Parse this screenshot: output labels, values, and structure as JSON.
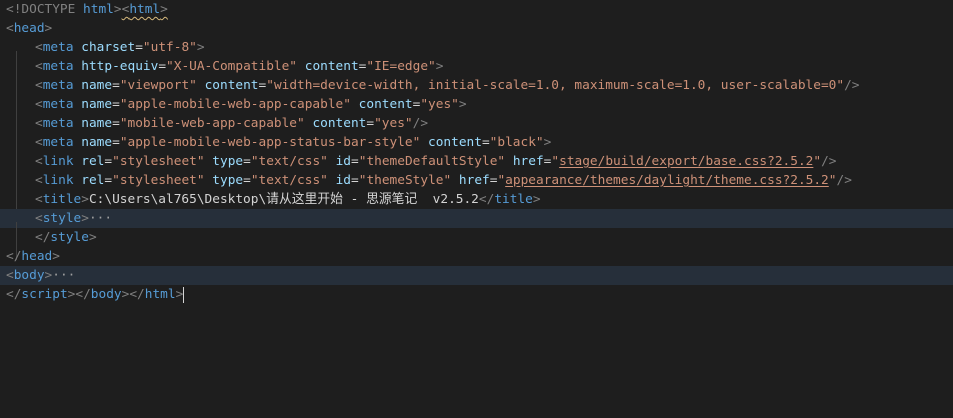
{
  "editor": {
    "lines": [
      {
        "doctype": "<!DOCTYPE ",
        "doctype_kw": "html",
        "close": ">",
        "html_open": "<",
        "html_tag": "html",
        "html_close": ">"
      },
      {
        "open": "<",
        "tag": "head",
        "close": ">"
      },
      {
        "open": "<",
        "tag": "meta",
        "attr1": "charset",
        "val1": "\"utf-8\"",
        "end": ">"
      },
      {
        "open": "<",
        "tag": "meta",
        "attr1": "http-equiv",
        "val1": "\"X-UA-Compatible\"",
        "attr2": "content",
        "val2": "\"IE=edge\"",
        "end": ">"
      },
      {
        "open": "<",
        "tag": "meta",
        "attr1": "name",
        "val1": "\"viewport\"",
        "attr2": "content",
        "val2": "\"width=device-width, initial-scale=1.0, maximum-scale=1.0, user-scalable=0\"",
        "end": "/>"
      },
      {
        "open": "<",
        "tag": "meta",
        "attr1": "name",
        "val1": "\"apple-mobile-web-app-capable\"",
        "attr2": "content",
        "val2": "\"yes\"",
        "end": ">"
      },
      {
        "open": "<",
        "tag": "meta",
        "attr1": "name",
        "val1": "\"mobile-web-app-capable\"",
        "attr2": "content",
        "val2": "\"yes\"",
        "end": "/>"
      },
      {
        "open": "<",
        "tag": "meta",
        "attr1": "name",
        "val1": "\"apple-mobile-web-app-status-bar-style\"",
        "attr2": "content",
        "val2": "\"black\"",
        "end": ">"
      },
      {
        "open": "<",
        "tag": "link",
        "attr1": "rel",
        "val1": "\"stylesheet\"",
        "attr2": "type",
        "val2": "\"text/css\"",
        "attr3": "id",
        "val3": "\"themeDefaultStyle\"",
        "attr4": "href",
        "val4_q1": "\"",
        "val4": "stage/build/export/base.css?2.5.2",
        "val4_q2": "\"",
        "end": "/>"
      },
      {
        "open": "<",
        "tag": "link",
        "attr1": "rel",
        "val1": "\"stylesheet\"",
        "attr2": "type",
        "val2": "\"text/css\"",
        "attr3": "id",
        "val3": "\"themeStyle\"",
        "attr4": "href",
        "val4_q1": "\"",
        "val4": "appearance/themes/daylight/theme.css?2.5.2",
        "val4_q2": "\"",
        "end": "/>"
      },
      {
        "open": "<",
        "tag": "title",
        "close": ">",
        "text": "C:\\Users\\al765\\Desktop\\请从这里开始 - 思源笔记  v2.5.2",
        "end_open": "</",
        "end_tag": "title",
        "end_close": ">"
      },
      {
        "open": "<",
        "tag": "style",
        "close": ">",
        "fold": "···"
      },
      {
        "open": "</",
        "tag": "style",
        "close": ">"
      },
      {
        "open": "</",
        "tag": "head",
        "close": ">"
      },
      {
        "open": "<",
        "tag": "body",
        "close": ">",
        "fold": "···"
      },
      {
        "open1": "</",
        "tag1": "script",
        "close1": ">",
        "open2": "</",
        "tag2": "body",
        "close2": ">",
        "open3": "</",
        "tag3": "html",
        "close3": ">"
      }
    ]
  },
  "colors": {
    "background": "#1e1e1e",
    "tag": "#569cd6",
    "attribute": "#9cdcfe",
    "string": "#ce9178",
    "bracket": "#808080",
    "text": "#d4d4d4"
  }
}
